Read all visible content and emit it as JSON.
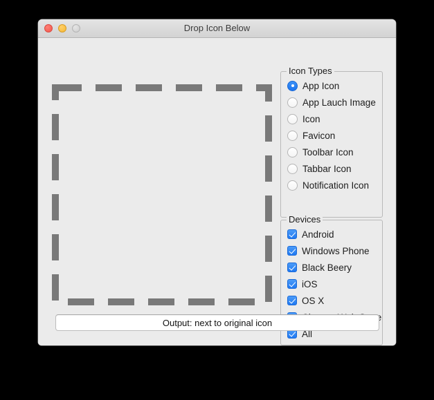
{
  "window": {
    "title": "Drop Icon Below",
    "traffic_lights": [
      {
        "name": "close",
        "color": "#f2564b"
      },
      {
        "name": "minimize",
        "color": "#f5b733"
      },
      {
        "name": "zoom",
        "color": "#cdcdcd"
      }
    ]
  },
  "dropzone": {
    "label": "drop-icon-area",
    "border_color": "#797979",
    "dash_length": 38,
    "dash_gap": 20,
    "border_width": 10
  },
  "icon_types": {
    "title": "Icon Types",
    "options": [
      {
        "label": "App Icon",
        "checked": true
      },
      {
        "label": "App Lauch Image",
        "checked": false
      },
      {
        "label": "Icon",
        "checked": false
      },
      {
        "label": "Favicon",
        "checked": false
      },
      {
        "label": "Toolbar Icon",
        "checked": false
      },
      {
        "label": "Tabbar Icon",
        "checked": false
      },
      {
        "label": "Notification Icon",
        "checked": false
      }
    ]
  },
  "devices": {
    "title": "Devices",
    "options": [
      {
        "label": "Android",
        "checked": true
      },
      {
        "label": "Windows Phone",
        "checked": true
      },
      {
        "label": "Black Beery",
        "checked": true
      },
      {
        "label": "iOS",
        "checked": true
      },
      {
        "label": "OS X",
        "checked": true
      },
      {
        "label": "Chrome Web Store",
        "checked": true
      },
      {
        "label": "All",
        "checked": true
      }
    ]
  },
  "output": {
    "text": "Output: next to original icon"
  },
  "colors": {
    "accent": "#1f79f2",
    "window_bg": "#ebebeb",
    "titlebar_bg": "#d8d8d8",
    "dash_gray": "#797979"
  }
}
